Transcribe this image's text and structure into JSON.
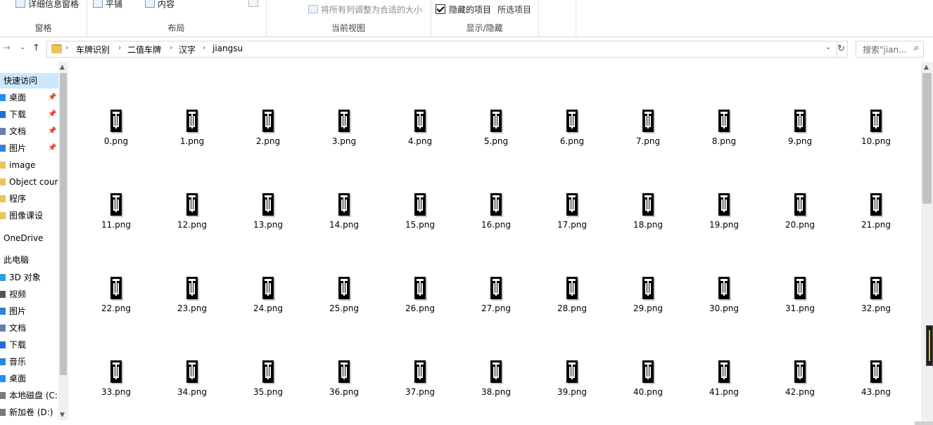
{
  "ribbon": {
    "groups": [
      {
        "label": "窗格"
      },
      {
        "label": "布局"
      },
      {
        "label": "当前视图"
      },
      {
        "label": "显示/隐藏"
      }
    ],
    "details_pane": "详细信息窗格",
    "tiles": "平铺",
    "content": "内容",
    "fit_columns": "将所有列调整为合适的大小",
    "hidden_items": "隐藏的项目",
    "hide_selected": "所选项目"
  },
  "nav": {
    "back_icon": "arrow-right-icon",
    "breadcrumb": [
      "车牌识别",
      "二值车牌",
      "汉字",
      "jiangsu"
    ],
    "search_placeholder": "搜索\"jian..."
  },
  "sidebar": {
    "items": [
      {
        "label": "快速访问",
        "type": "header",
        "active": true
      },
      {
        "label": "桌面",
        "icon": "desktop-icon",
        "pinned": true,
        "color": "#1e90ff"
      },
      {
        "label": "下载",
        "icon": "download-icon",
        "pinned": true,
        "color": "#1e6fd9"
      },
      {
        "label": "文档",
        "icon": "document-icon",
        "pinned": true,
        "color": "#6a7ea8"
      },
      {
        "label": "图片",
        "icon": "picture-icon",
        "pinned": true,
        "color": "#2f84d6"
      },
      {
        "label": "image",
        "icon": "folder-icon",
        "color": "#e8c45a"
      },
      {
        "label": "Object cour",
        "icon": "folder-icon",
        "color": "#e8c45a"
      },
      {
        "label": "程序",
        "icon": "folder-icon",
        "color": "#e8c45a"
      },
      {
        "label": "图像课设",
        "icon": "folder-icon",
        "color": "#e8c45a"
      },
      {
        "label": "OneDrive",
        "type": "header"
      },
      {
        "label": "此电脑",
        "type": "header"
      },
      {
        "label": "3D 对象",
        "icon": "3d-objects-icon",
        "color": "#2aa0d8"
      },
      {
        "label": "视频",
        "icon": "video-icon",
        "color": "#555555"
      },
      {
        "label": "图片",
        "icon": "picture-icon",
        "color": "#2f84d6"
      },
      {
        "label": "文档",
        "icon": "document-icon",
        "color": "#6a7ea8"
      },
      {
        "label": "下载",
        "icon": "download-icon",
        "color": "#1e6fd9"
      },
      {
        "label": "音乐",
        "icon": "music-icon",
        "color": "#2f84d6"
      },
      {
        "label": "桌面",
        "icon": "desktop-icon",
        "color": "#1e90ff"
      },
      {
        "label": "本地磁盘 (C:",
        "icon": "drive-icon",
        "color": "#7a7a7a"
      },
      {
        "label": "新加卷 (D:)",
        "icon": "drive-icon",
        "color": "#7a7a7a"
      }
    ]
  },
  "files": [
    "0.png",
    "1.png",
    "2.png",
    "3.png",
    "4.png",
    "5.png",
    "6.png",
    "7.png",
    "8.png",
    "9.png",
    "10.png",
    "11.png",
    "12.png",
    "13.png",
    "14.png",
    "15.png",
    "16.png",
    "17.png",
    "18.png",
    "19.png",
    "20.png",
    "21.png",
    "22.png",
    "23.png",
    "24.png",
    "25.png",
    "26.png",
    "27.png",
    "28.png",
    "29.png",
    "30.png",
    "31.png",
    "32.png",
    "33.png",
    "34.png",
    "35.png",
    "36.png",
    "37.png",
    "38.png",
    "39.png",
    "40.png",
    "41.png",
    "42.png",
    "43.png"
  ]
}
